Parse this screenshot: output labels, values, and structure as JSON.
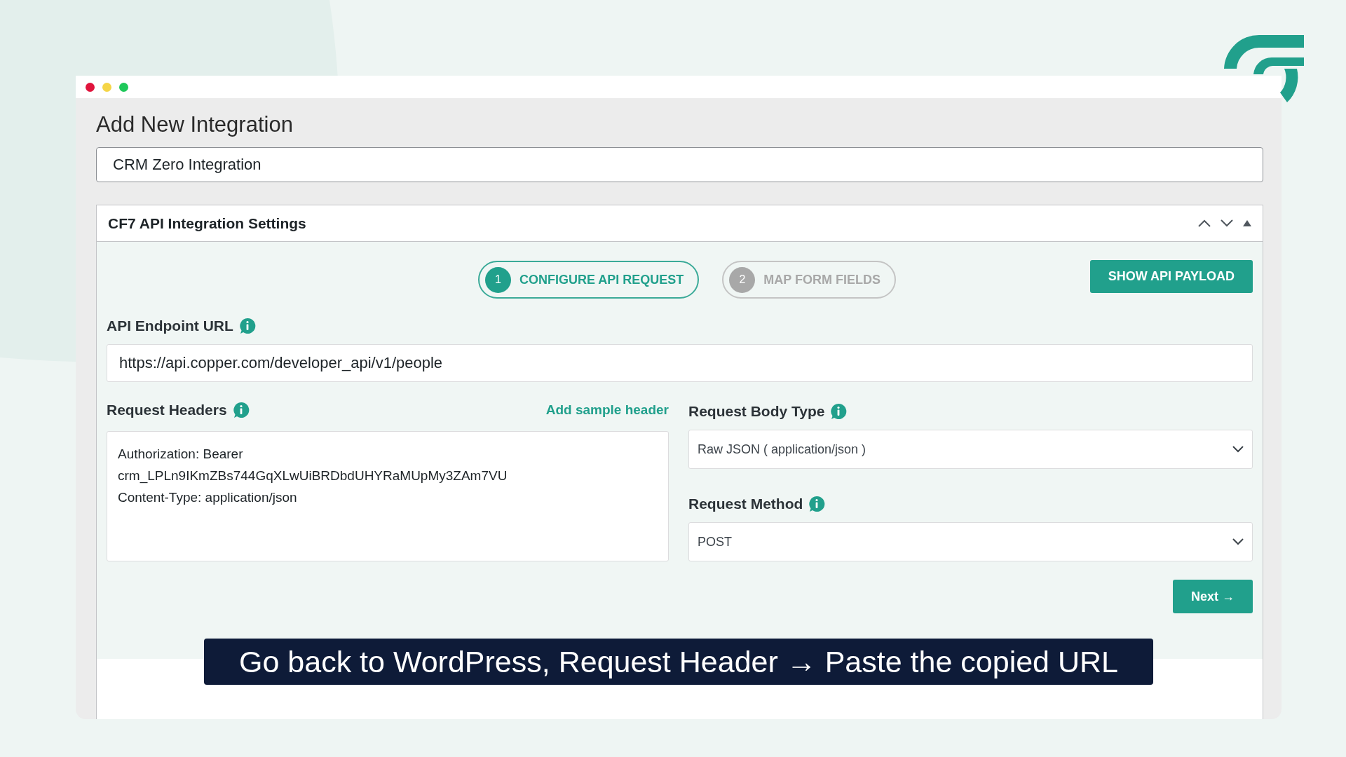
{
  "page": {
    "title": "Add New Integration",
    "name_value": "CRM Zero Integration"
  },
  "panel": {
    "title": "CF7 API Integration Settings",
    "steps": [
      {
        "number": "1",
        "label": "CONFIGURE API REQUEST",
        "selected": true
      },
      {
        "number": "2",
        "label": "MAP FORM FIELDS",
        "selected": false
      }
    ],
    "payload_button": "SHOW API PAYLOAD",
    "endpoint": {
      "label": "API Endpoint URL",
      "value": "https://api.copper.com/developer_api/v1/people"
    },
    "headers": {
      "label": "Request Headers",
      "link": "Add sample header",
      "value": "Authorization: Bearer\ncrm_LPLn9IKmZBs744GqXLwUiBRDbdUHYRaMUpMy3ZAm7VU\nContent-Type: application/json"
    },
    "body_type": {
      "label": "Request Body Type",
      "value": "Raw JSON ( application/json )"
    },
    "method": {
      "label": "Request Method",
      "value": "POST"
    },
    "next_button": "Next →"
  },
  "caption": "Go back to WordPress, Request Header → Paste the copied URL"
}
